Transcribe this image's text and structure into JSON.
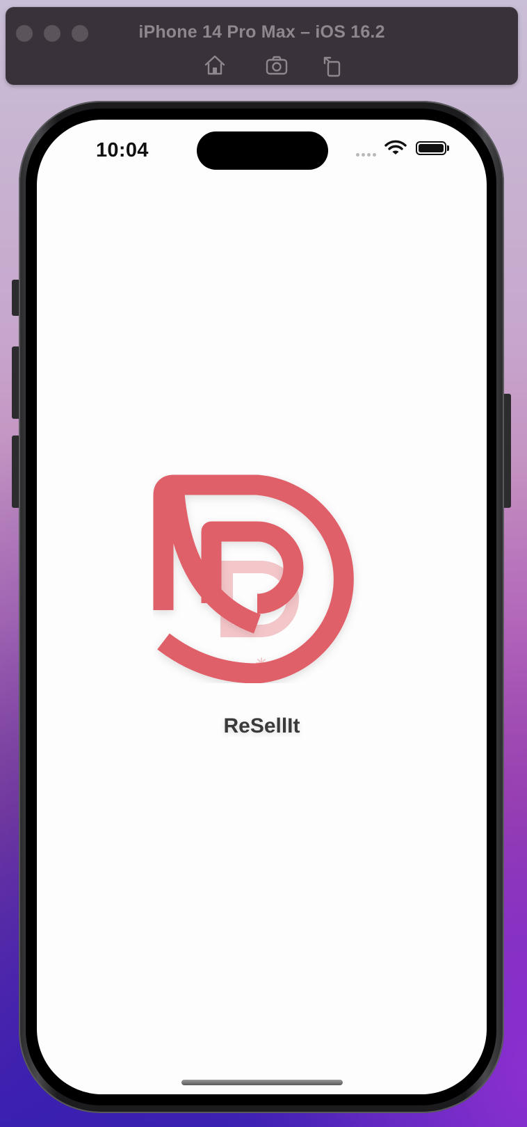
{
  "simulator": {
    "title": "iPhone 14 Pro Max – iOS 16.2",
    "toolbar": [
      {
        "name": "home-icon"
      },
      {
        "name": "screenshot-icon"
      },
      {
        "name": "rotate-icon"
      }
    ]
  },
  "status_bar": {
    "time": "10:04",
    "icons": [
      "signal-icon",
      "wifi-icon",
      "battery-icon"
    ]
  },
  "splash": {
    "app_name": "ReSellIt",
    "logo_icon": "app-logo-icon",
    "brand_color": "#e0606a",
    "background_color": "#fdfdfd"
  }
}
